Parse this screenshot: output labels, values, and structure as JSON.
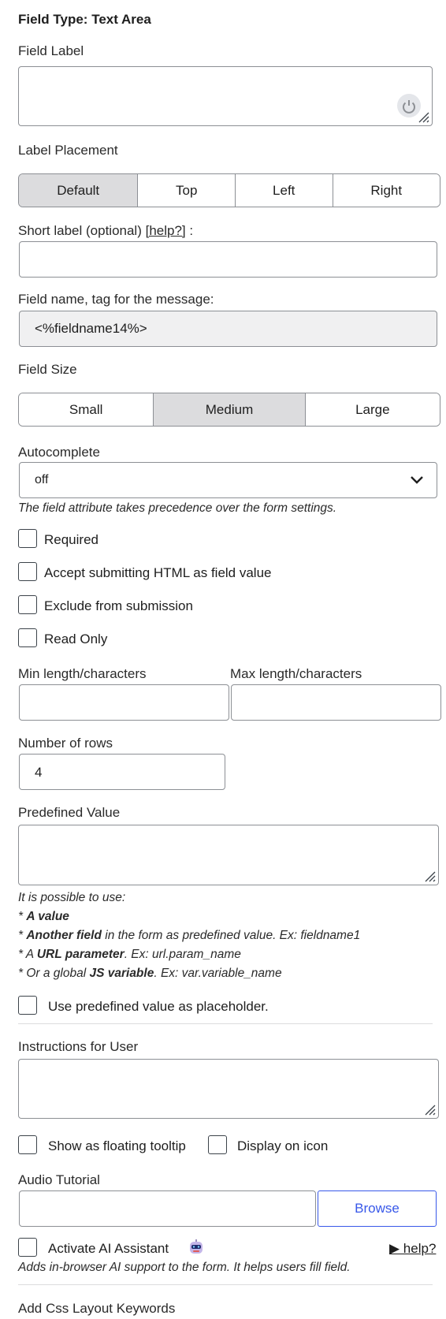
{
  "title": "Field Type: Text Area",
  "field_label": {
    "label": "Field Label",
    "value": ""
  },
  "label_placement": {
    "label": "Label Placement",
    "options": [
      "Default",
      "Top",
      "Left",
      "Right"
    ],
    "selected": "Default"
  },
  "short_label": {
    "label": "Short label (optional)",
    "help_link": "[help?]",
    "suffix": " :",
    "value": ""
  },
  "field_name": {
    "label": "Field name, tag for the message:",
    "value": "<%fieldname14%>"
  },
  "field_size": {
    "label": "Field Size",
    "options": [
      "Small",
      "Medium",
      "Large"
    ],
    "selected": "Medium"
  },
  "autocomplete": {
    "label": "Autocomplete",
    "value": "off",
    "note": "The field attribute takes precedence over the form settings."
  },
  "checkboxes": {
    "required": "Required",
    "accept_html": "Accept submitting HTML as field value",
    "exclude": "Exclude from submission",
    "read_only": "Read Only"
  },
  "min_length": {
    "label": "Min length/characters",
    "value": ""
  },
  "max_length": {
    "label": "Max length/characters",
    "value": ""
  },
  "rows": {
    "label": "Number of rows",
    "value": "4"
  },
  "predefined": {
    "label": "Predefined Value",
    "value": "",
    "help_intro": "It is possible to use:",
    "help_1_prefix": "* ",
    "help_1_bold": "A value",
    "help_2_prefix": "* ",
    "help_2_bold": "Another field",
    "help_2_rest": " in the form as predefined value. Ex: fieldname1",
    "help_3_prefix": "* A ",
    "help_3_bold": "URL parameter",
    "help_3_rest": ". Ex: url.param_name",
    "help_4_prefix": "* Or a global ",
    "help_4_bold": "JS variable",
    "help_4_rest": ". Ex: var.variable_name",
    "placeholder_checkbox": "Use predefined value as placeholder."
  },
  "instructions": {
    "label": "Instructions for User",
    "value": ""
  },
  "tooltip_checkbox": "Show as floating tooltip",
  "icon_checkbox": "Display on icon",
  "audio": {
    "label": "Audio Tutorial",
    "value": "",
    "browse": "Browse"
  },
  "ai": {
    "checkbox": "Activate AI Assistant",
    "help": "▶ help?",
    "note": "Adds in-browser AI support to the form. It helps users fill field."
  },
  "css": {
    "label": "Add Css Layout Keywords",
    "value": ""
  },
  "colors": {
    "accent": "#3858e9",
    "active_segment": "#dcdcde",
    "disabled_bg": "#f0f0f1"
  }
}
